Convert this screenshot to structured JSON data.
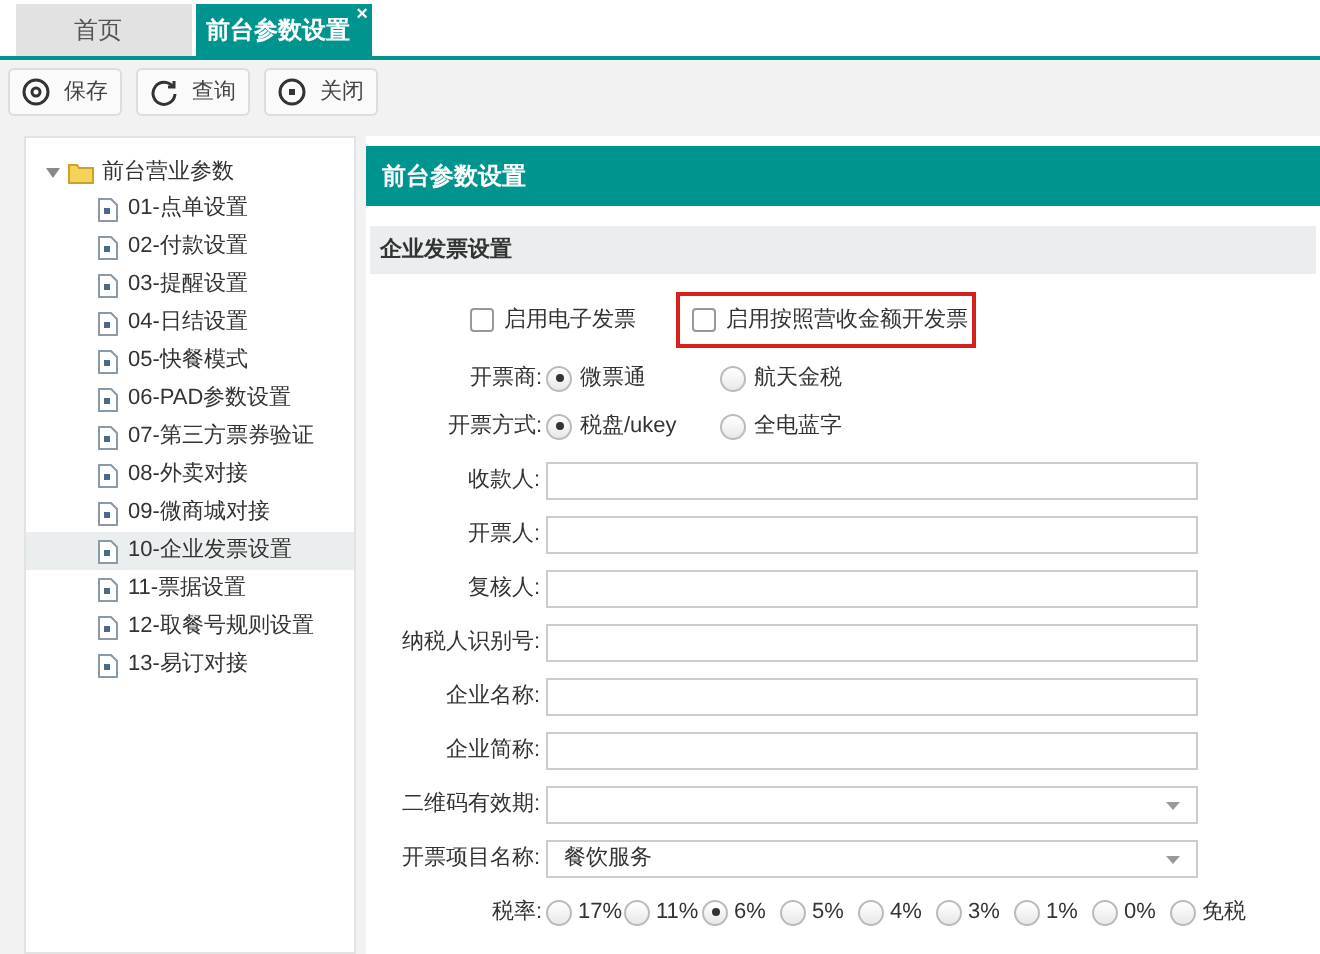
{
  "tabs": [
    {
      "label": "首页",
      "selected": false
    },
    {
      "label": "前台参数设置",
      "selected": true,
      "close": "×"
    }
  ],
  "toolbar": [
    {
      "label": "保存",
      "kind": "save"
    },
    {
      "label": "查询",
      "kind": "query"
    },
    {
      "label": "关闭",
      "kind": "close"
    }
  ],
  "tree": {
    "label": "前台营业参数",
    "expanded": true,
    "children": [
      {
        "label": "01-点单设置",
        "selected": false
      },
      {
        "label": "02-付款设置",
        "selected": false
      },
      {
        "label": "03-提醒设置",
        "selected": false
      },
      {
        "label": "04-日结设置",
        "selected": false
      },
      {
        "label": "05-快餐模式",
        "selected": false
      },
      {
        "label": "06-PAD参数设置",
        "selected": false
      },
      {
        "label": "07-第三方票券验证",
        "selected": false
      },
      {
        "label": "08-外卖对接",
        "selected": false
      },
      {
        "label": "09-微商城对接",
        "selected": false
      },
      {
        "label": "10-企业发票设置",
        "selected": true
      },
      {
        "label": "11-票据设置",
        "selected": false
      },
      {
        "label": "12-取餐号规则设置",
        "selected": false
      },
      {
        "label": "13-易订对接",
        "selected": false
      }
    ]
  },
  "panel": {
    "title": "前台参数设置",
    "section": "企业发票设置",
    "checkboxes": [
      {
        "label": "启用电子发票",
        "checked": false,
        "highlighted": false
      },
      {
        "label": "启用按照营收金额开发票",
        "checked": false,
        "highlighted": true
      }
    ],
    "radio_groups": [
      {
        "label": "开票商:",
        "options": [
          {
            "label": "微票通",
            "selected": true
          },
          {
            "label": "航天金税",
            "selected": false
          }
        ]
      },
      {
        "label": "开票方式:",
        "options": [
          {
            "label": "税盘/ukey",
            "selected": true
          },
          {
            "label": "全电蓝字",
            "selected": false
          }
        ]
      }
    ],
    "fields": [
      {
        "label": "收款人:",
        "kind": "text"
      },
      {
        "label": "开票人:",
        "kind": "text"
      },
      {
        "label": "复核人:",
        "kind": "text"
      },
      {
        "label": "纳税人识别号:",
        "kind": "text"
      },
      {
        "label": "企业名称:",
        "kind": "text"
      },
      {
        "label": "企业简称:",
        "kind": "text"
      },
      {
        "label": "二维码有效期:",
        "kind": "select"
      },
      {
        "label": "开票项目名称:",
        "kind": "select",
        "value": "餐饮服务"
      }
    ],
    "tax_rate": {
      "label": "税率:",
      "options": [
        {
          "label": "17%",
          "selected": false
        },
        {
          "label": "11%",
          "selected": false
        },
        {
          "label": "6%",
          "selected": true
        },
        {
          "label": "5%",
          "selected": false
        },
        {
          "label": "4%",
          "selected": false
        },
        {
          "label": "3%",
          "selected": false
        },
        {
          "label": "1%",
          "selected": false
        },
        {
          "label": "0%",
          "selected": false
        },
        {
          "label": "免税",
          "selected": false
        }
      ]
    }
  }
}
